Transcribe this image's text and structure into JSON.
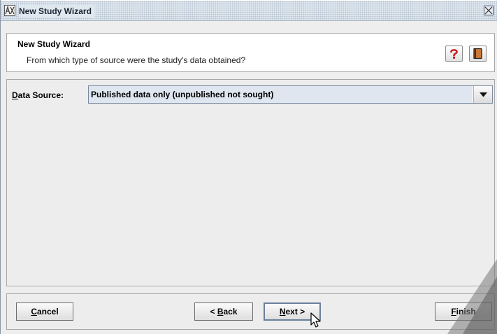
{
  "window": {
    "title": "New Study Wizard"
  },
  "header": {
    "title": "New Study Wizard",
    "subtitle": "From which type of source were the study's data obtained?",
    "help_icon": "question-mark-icon",
    "book_icon": "book-icon"
  },
  "content": {
    "data_source_label_mnemonic": "D",
    "data_source_label_rest": "ata Source:",
    "data_source_value": "Published data only (unpublished not sought)"
  },
  "footer": {
    "cancel_mnemonic": "C",
    "cancel_rest": "ancel",
    "back_prefix": "< ",
    "back_mnemonic": "B",
    "back_rest": "ack",
    "next_mnemonic": "N",
    "next_rest": "ext >",
    "finish_mnemonic": "F",
    "finish_rest": "inish"
  },
  "colors": {
    "selection": "#dfe6f0",
    "window_bg": "#eeeeee",
    "help_icon": "#c81e1e",
    "book_icon": "#c8793a"
  }
}
